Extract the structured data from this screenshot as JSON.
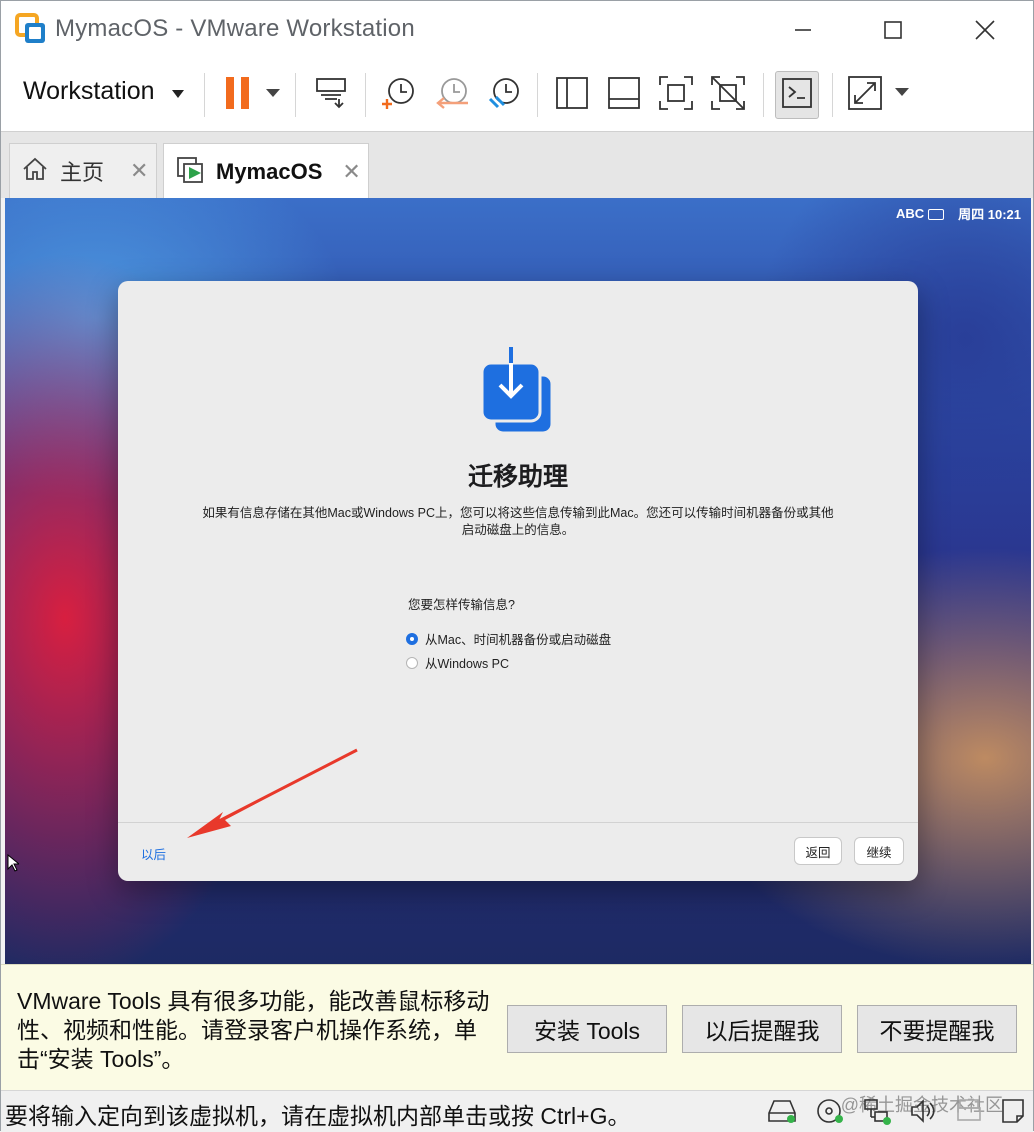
{
  "window": {
    "title": "MymacOS - VMware Workstation",
    "controls": [
      "minimize",
      "maximize",
      "close"
    ]
  },
  "toolbar": {
    "workstation_label": "Workstation",
    "buttons": [
      "pause-icon",
      "send-ctrl-alt-del-icon",
      "take-snapshot-icon",
      "revert-snapshot-icon",
      "manage-snapshots-icon",
      "show-library-icon",
      "show-thumbnail-bar-icon",
      "full-screen-icon",
      "unity-icon",
      "console-view-icon",
      "stretch-guest-icon"
    ]
  },
  "tabs": [
    {
      "label": "主页",
      "active": false
    },
    {
      "label": "MymacOS",
      "active": true
    }
  ],
  "guest": {
    "menubar": {
      "input_source": "ABC",
      "clock": "周四 10:21"
    },
    "dialog": {
      "title": "迁移助理",
      "description": "如果有信息存储在其他Mac或Windows PC上，您可以将这些信息传输到此Mac。您还可以传输时间机器备份或其他启动磁盘上的信息。",
      "question": "您要怎样传输信息?",
      "options": [
        {
          "label": "从Mac、时间机器备份或启动磁盘",
          "selected": true
        },
        {
          "label": "从Windows PC",
          "selected": false
        }
      ],
      "later_label": "以后",
      "back_label": "返回",
      "continue_label": "继续"
    },
    "annotation_color": "#e8392b"
  },
  "tools_bar": {
    "message": "VMware Tools 具有很多功能，能改善鼠标移动性、视频和性能。请登录客户机操作系统，单击“安装 Tools”。",
    "install_label": "安装 Tools",
    "remind_later_label": "以后提醒我",
    "never_remind_label": "不要提醒我"
  },
  "statusbar": {
    "message": "要将输入定向到该虚拟机，请在虚拟机内部单击或按 Ctrl+G。",
    "watermark": "@稀土掘金技术社区"
  },
  "colors": {
    "accent_orange": "#f26b1d",
    "mac_blue": "#1e6fe0",
    "tools_bar_bg": "#fbfbe4"
  }
}
